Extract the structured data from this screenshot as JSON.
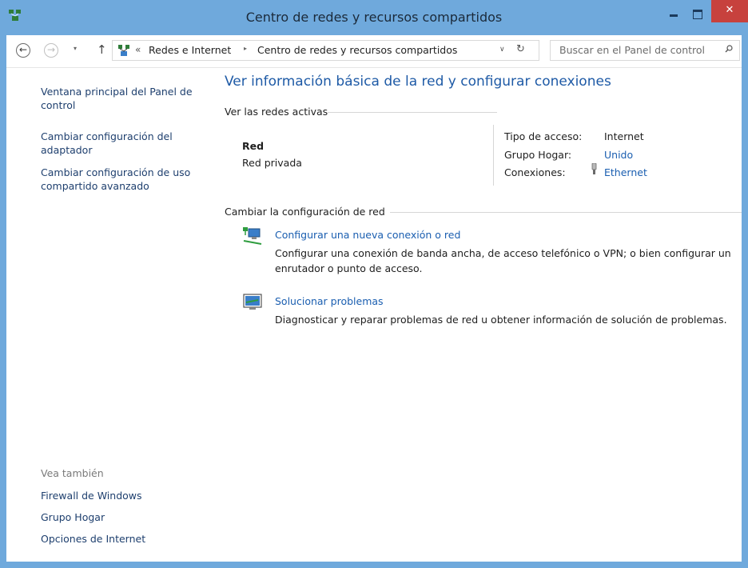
{
  "window": {
    "title": "Centro de redes y recursos compartidos",
    "close_label": "✕"
  },
  "nav": {
    "back_label": "←",
    "forward_label": "→",
    "recent_label": "▾",
    "up_label": "↑",
    "address_prefix": "«",
    "breadcrumbs": [
      "Redes e Internet",
      "Centro de redes y recursos compartidos"
    ],
    "breadcrumb_separator": "▸",
    "dropdown_label": "∨",
    "refresh_label": "↻",
    "search_placeholder": "Buscar en el Panel de control"
  },
  "sidebar": {
    "links": [
      {
        "label_line1": "Ventana principal del Panel de",
        "label_line2": "control"
      },
      {
        "label_line1": "Cambiar configuración del",
        "label_line2": "adaptador"
      },
      {
        "label_line1": "Cambiar configuración de uso",
        "label_line2": "compartido avanzado"
      }
    ],
    "see_also_heading": "Vea también",
    "see_also": [
      "Firewall de Windows",
      "Grupo Hogar",
      "Opciones de Internet"
    ]
  },
  "main": {
    "title": "Ver información básica de la red y configurar conexiones",
    "active_networks_heading": "Ver las redes activas",
    "network": {
      "name": "Red",
      "type": "Red privada",
      "access_label": "Tipo de acceso:",
      "access_value": "Internet",
      "homegroup_label": "Grupo Hogar:",
      "homegroup_value": "Unido",
      "connections_label": "Conexiones:",
      "connections_value": "Ethernet"
    },
    "change_heading": "Cambiar la configuración de red",
    "tasks": [
      {
        "icon": "new-connection-icon",
        "title": "Configurar una nueva conexión o red",
        "desc_line1": "Configurar una conexión de banda ancha, de acceso telefónico o VPN; o bien configurar un",
        "desc_line2": "enrutador o punto de acceso."
      },
      {
        "icon": "troubleshoot-icon",
        "title": "Solucionar problemas",
        "desc_line1": "Diagnosticar y reparar problemas de red u obtener información de solución de problemas."
      }
    ]
  },
  "colors": {
    "title_bar": "#6fa9dc",
    "link": "#1a5eb0",
    "sidebar_link": "#1e3f6e",
    "close_button": "#c7413d"
  }
}
